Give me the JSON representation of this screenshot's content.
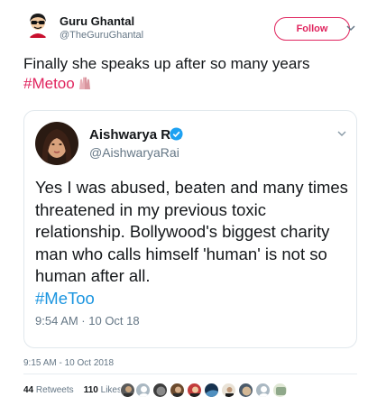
{
  "author": {
    "name": "Guru Ghantal",
    "handle": "@TheGuruGhantal",
    "follow_label": "Follow"
  },
  "tweet": {
    "text": "Finally she speaks up after so many years",
    "hashtag": "#Metoo",
    "emoji": "raised-hands-emoji"
  },
  "quoted": {
    "name": "Aishwarya Rai",
    "verified": true,
    "handle": "@AishwaryaRai",
    "text": "Yes I was abused, beaten and many times threatened in my previous toxic relationship. Bollywood's biggest charity man who calls himself 'human' is not so human after all.",
    "hashtag": "#MeToo",
    "time": "9:54 AM · 10 Oct 18"
  },
  "timestamp": "9:15 AM - 10 Oct 2018",
  "stats": {
    "retweets_count": "44",
    "retweets_label": "Retweets",
    "likes_count": "110",
    "likes_label": "Likes"
  },
  "likers": [
    "liker-1",
    "liker-2",
    "liker-3",
    "liker-4",
    "liker-5",
    "liker-6",
    "liker-7",
    "liker-8",
    "liker-9",
    "liker-10"
  ],
  "colors": {
    "follow": "#e0245e",
    "hashtag": "#e0245e",
    "link": "#1b95e0",
    "secondary_text": "#657786",
    "verified": "#1da1f2"
  }
}
